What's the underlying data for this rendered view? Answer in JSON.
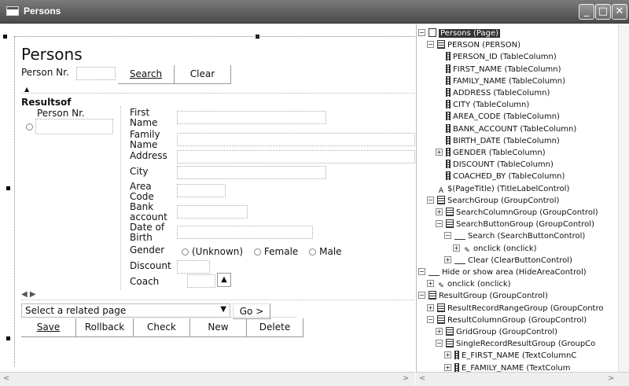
{
  "window": {
    "title": "Persons"
  },
  "form": {
    "page_title": "Persons",
    "search_label": "Person Nr.",
    "search_button": "Search",
    "clear_button": "Clear",
    "hide_arrow": "▲",
    "results_label": "Resultsof",
    "grid_column": "Person Nr.",
    "fields": [
      {
        "label": "First Name"
      },
      {
        "label": "Family Name"
      },
      {
        "label": "Address"
      },
      {
        "label": "City"
      },
      {
        "label": "Area Code"
      },
      {
        "label": "Bank account"
      },
      {
        "label": "Date of Birth"
      },
      {
        "label": "Gender"
      },
      {
        "label": "Discount"
      },
      {
        "label": "Coach"
      }
    ],
    "gender_options": [
      "(Unknown)",
      "Female",
      "Male"
    ],
    "range_arrows": "◀ ▶",
    "related_select": "Select a related page",
    "go_button": "Go >",
    "actions": {
      "save": "Save",
      "rollback": "Rollback",
      "check": "Check",
      "new": "New",
      "delete": "Delete"
    }
  },
  "tree": [
    {
      "text": "Persons (Page)",
      "level": 0,
      "icon": "page-icon",
      "exp": "⊟",
      "selected": true
    },
    {
      "text": "PERSON (PERSON)",
      "level": 1,
      "icon": "table-icon",
      "exp": "⊟"
    },
    {
      "text": "PERSON_ID (TableColumn)",
      "level": 2,
      "icon": "column-icon"
    },
    {
      "text": "FIRST_NAME (TableColumn)",
      "level": 2,
      "icon": "column-icon"
    },
    {
      "text": "FAMILY_NAME (TableColumn)",
      "level": 2,
      "icon": "column-icon"
    },
    {
      "text": "ADDRESS (TableColumn)",
      "level": 2,
      "icon": "column-icon"
    },
    {
      "text": "CITY (TableColumn)",
      "level": 2,
      "icon": "column-icon"
    },
    {
      "text": "AREA_CODE (TableColumn)",
      "level": 2,
      "icon": "column-icon"
    },
    {
      "text": "BANK_ACCOUNT (TableColumn)",
      "level": 2,
      "icon": "column-icon"
    },
    {
      "text": "BIRTH_DATE (TableColumn)",
      "level": 2,
      "icon": "column-icon"
    },
    {
      "text": "GENDER (TableColumn)",
      "level": 2,
      "icon": "column-icon",
      "exp": "⊞"
    },
    {
      "text": "DISCOUNT (TableColumn)",
      "level": 2,
      "icon": "column-icon"
    },
    {
      "text": "COACHED_BY (TableColumn)",
      "level": 2,
      "icon": "column-icon"
    },
    {
      "text": "$(PageTitle) (TitleLabelControl)",
      "level": 1,
      "icon": "title-label-icon"
    },
    {
      "text": "SearchGroup (GroupControl)",
      "level": 1,
      "icon": "group-icon",
      "exp": "⊟"
    },
    {
      "text": "SearchColumnGroup (GroupControl)",
      "level": 2,
      "icon": "group-icon",
      "exp": "⊞"
    },
    {
      "text": "SearchButtonGroup (GroupControl)",
      "level": 2,
      "icon": "group-icon",
      "exp": "⊟"
    },
    {
      "text": "Search (SearchButtonControl)",
      "level": 3,
      "icon": "button-icon",
      "exp": "⊟"
    },
    {
      "text": "onclick (onclick)",
      "level": 4,
      "icon": "event-icon",
      "exp": "⊞"
    },
    {
      "text": "Clear (ClearButtonControl)",
      "level": 3,
      "icon": "button-icon",
      "exp": "⊞"
    },
    {
      "text": "Hide or show area (HideAreaControl)",
      "level": 0,
      "icon": "button-icon",
      "exp": "⊟"
    },
    {
      "text": "onclick (onclick)",
      "level": 1,
      "icon": "event-icon",
      "exp": "⊞"
    },
    {
      "text": "ResultGroup (GroupControl)",
      "level": 0,
      "icon": "group-icon",
      "exp": "⊟"
    },
    {
      "text": "ResultRecordRangeGroup (GroupContro",
      "level": 1,
      "icon": "group-icon",
      "exp": "⊞"
    },
    {
      "text": "ResultColumnGroup (GroupControl)",
      "level": 1,
      "icon": "group-icon",
      "exp": "⊟"
    },
    {
      "text": "GridGroup (GroupControl)",
      "level": 2,
      "icon": "group-icon",
      "exp": "⊞"
    },
    {
      "text": "SingleRecordResultGroup (GroupCo",
      "level": 2,
      "icon": "group-icon",
      "exp": "⊟"
    },
    {
      "text": "E_FIRST_NAME (TextColumnC",
      "level": 3,
      "icon": "text-column-icon",
      "exp": "⊞"
    },
    {
      "text": "E_FAMILY_NAME (TextColum",
      "level": 3,
      "icon": "text-column-icon",
      "exp": "⊞"
    }
  ]
}
